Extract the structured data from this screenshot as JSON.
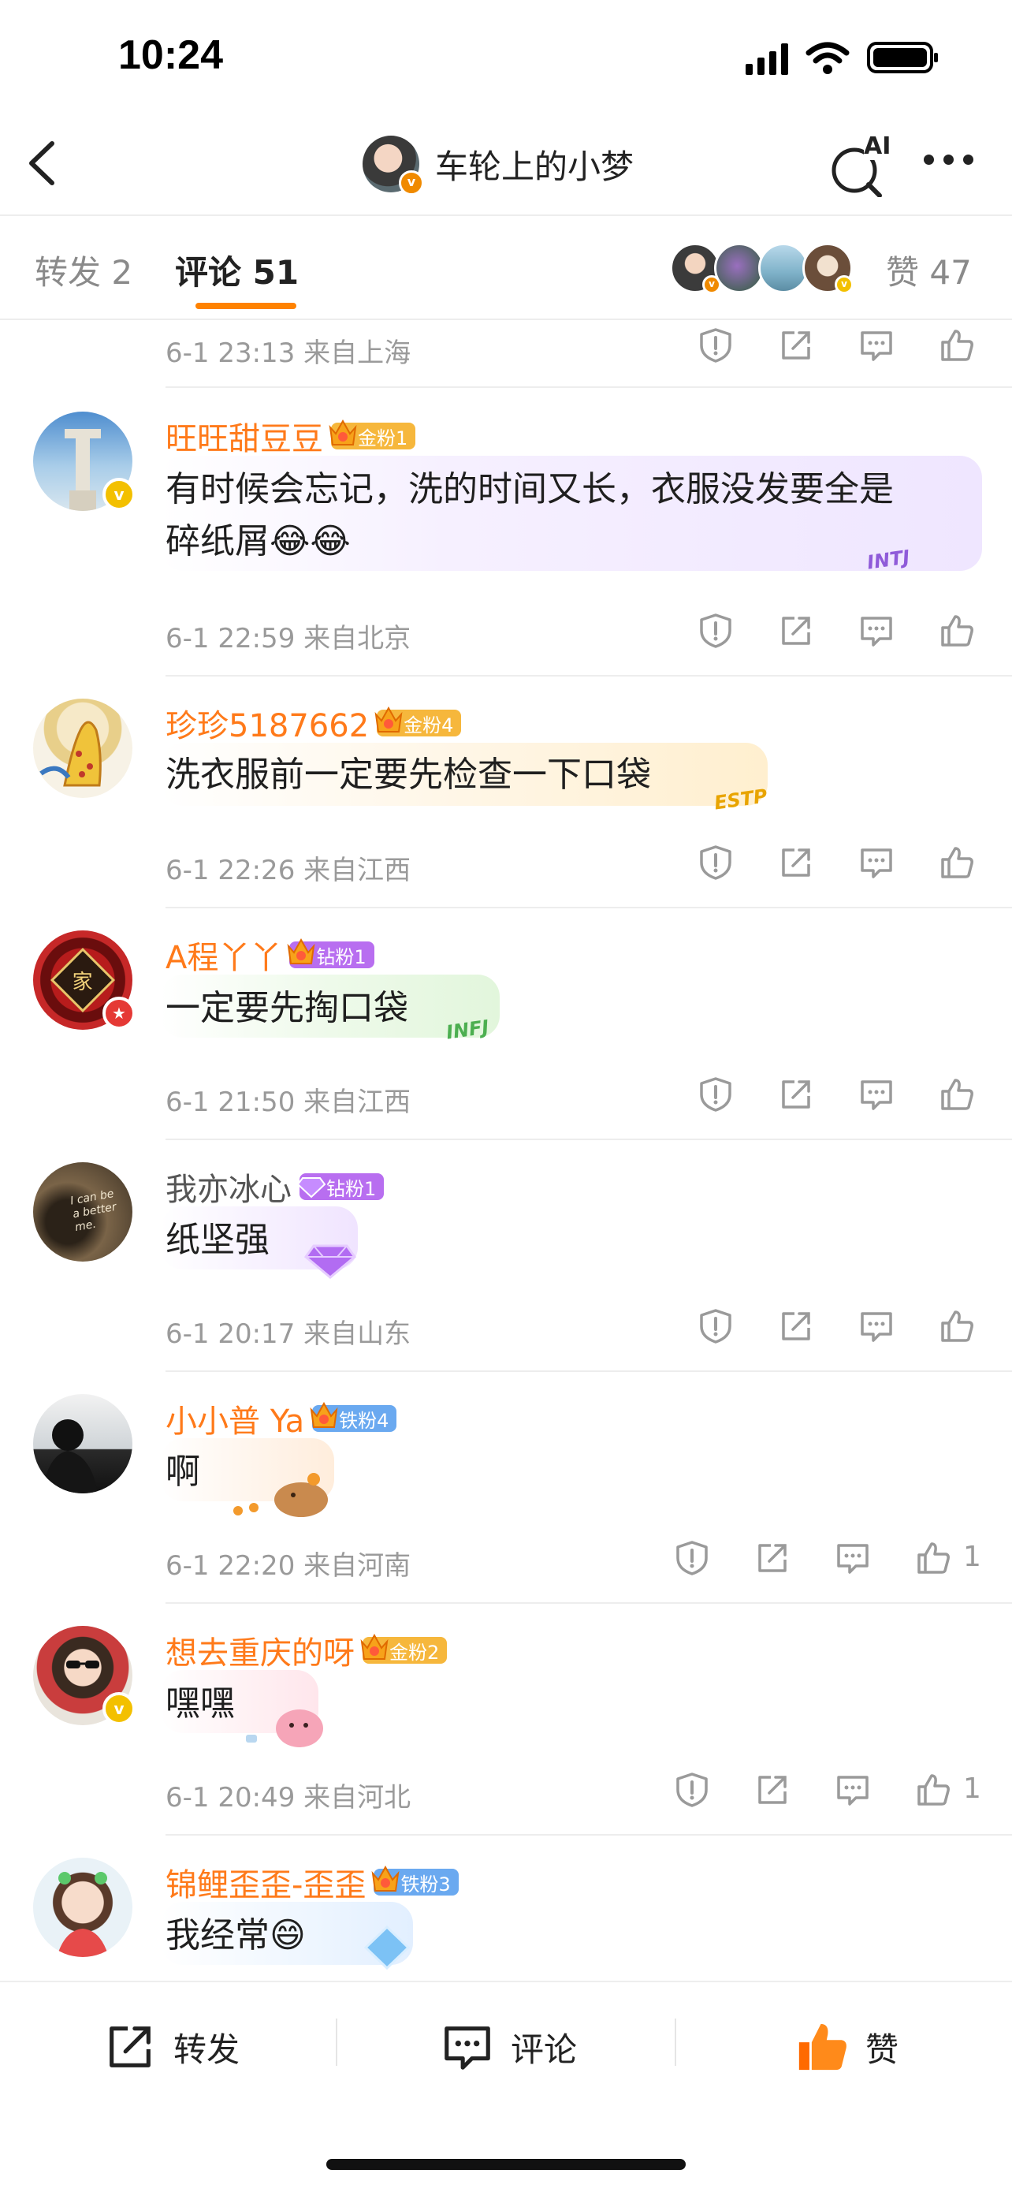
{
  "status_bar": {
    "time": "10:24"
  },
  "nav": {
    "title": "车轮上的小梦",
    "ai_label": "AI"
  },
  "tabs": {
    "repost": "转发 2",
    "comments": "评论 51",
    "likes": "赞 47"
  },
  "comments": [
    {
      "meta": "6-1 23:13  来自上海"
    },
    {
      "username": "旺旺甜豆豆",
      "fan_badge": "金粉1",
      "text_line1": "有时候会忘记，洗的时间又长，衣服没发要全是",
      "text_line2": "碎纸屑😂😂",
      "meta": "6-1 22:59  来自北京",
      "bubble_tag": "INTJ"
    },
    {
      "username": "珍珍5187662",
      "fan_badge": "金粉4",
      "text": "洗衣服前一定要先检查一下口袋",
      "meta": "6-1 22:26  来自江西",
      "bubble_tag": "ESTP"
    },
    {
      "username": "A程丫丫",
      "fan_badge": "钻粉1",
      "text": "一定要先掏口袋",
      "meta": "6-1 21:50  来自江西",
      "bubble_tag": "INFJ"
    },
    {
      "username": "我亦冰心",
      "fan_badge": "钻粉1",
      "text": "纸坚强",
      "meta": "6-1 20:17  来自山东"
    },
    {
      "username": "小小普 Ya",
      "fan_badge": "铁粉4",
      "text": "啊",
      "meta": "6-1 22:20  来自河南",
      "likes": "1"
    },
    {
      "username": "想去重庆的呀",
      "fan_badge": "金粉2",
      "text": "嘿嘿",
      "meta": "6-1 20:49  来自河北",
      "likes": "1"
    },
    {
      "username": "锦鲤歪歪-歪歪",
      "fan_badge": "铁粉3",
      "text": "我经常😄"
    }
  ],
  "bottom_bar": {
    "repost": "转发",
    "comment": "评论",
    "like": "赞"
  },
  "avatar_texts": {
    "family": "家",
    "quote": "I can be a better me."
  },
  "colors": {
    "accent": "#ff8200",
    "username": "#ff7a1a",
    "meta": "#9a9a9a",
    "gold_badge": "#f6b73c",
    "diamond_badge": "#b86ef0",
    "iron_badge": "#6aa9f0"
  }
}
